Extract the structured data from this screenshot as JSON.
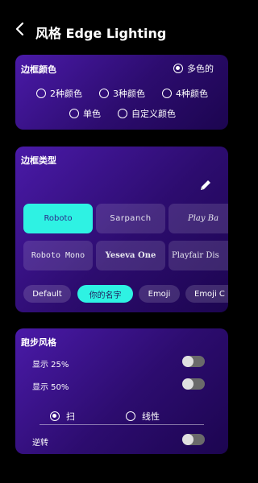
{
  "header": {
    "title": "风格 Edge Lighting"
  },
  "border_color": {
    "title": "边框颜色",
    "options": [
      {
        "label": "多色的",
        "selected": true
      },
      {
        "label": "2种颜色",
        "selected": false
      },
      {
        "label": "3种颜色",
        "selected": false
      },
      {
        "label": "4种颜色",
        "selected": false
      },
      {
        "label": "单色",
        "selected": false
      },
      {
        "label": "自定义颜色",
        "selected": false
      }
    ]
  },
  "border_type": {
    "title": "边框类型",
    "fonts": [
      {
        "label": "Roboto",
        "selected": true
      },
      {
        "label": "Sarpanch",
        "selected": false
      },
      {
        "label": "Play Ba",
        "selected": false
      },
      {
        "label": "Roboto Mono",
        "selected": false
      },
      {
        "label": "Yeseva One",
        "selected": false
      },
      {
        "label": "Playfair Dis",
        "selected": false
      }
    ],
    "chips": [
      {
        "label": "Default",
        "selected": false
      },
      {
        "label": "你的名字",
        "selected": true
      },
      {
        "label": "Emoji",
        "selected": false
      },
      {
        "label": "Emoji C",
        "selected": false
      }
    ]
  },
  "running_style": {
    "title": "跑步风格",
    "show_25": "显示 25%",
    "show_50": "显示 50%",
    "scan": "扫",
    "linear": "线性",
    "scan_selected": true,
    "reverse": "逆转"
  },
  "colors": {
    "accent": "#2ef2e3",
    "card_gradient_start": "#4a1aa8",
    "card_gradient_end": "#1c0550"
  }
}
